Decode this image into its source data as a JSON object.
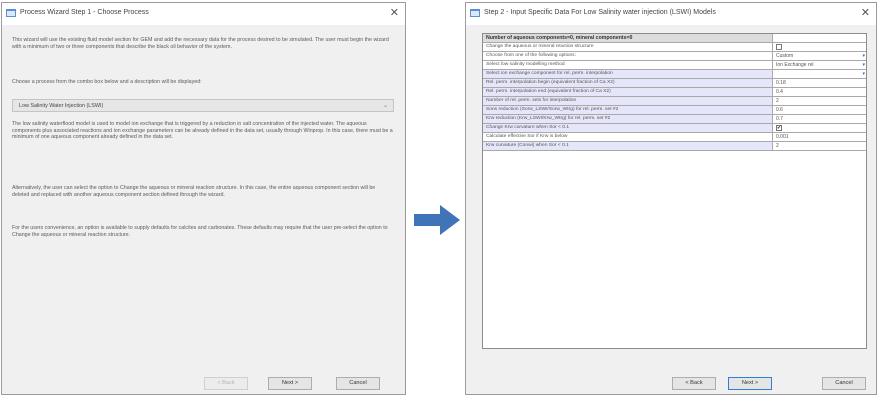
{
  "left_dialog": {
    "title": "Process Wizard Step 1 - Choose Process",
    "close": "✕",
    "paragraphs": [
      "This wizard will use the existing fluid model section for GEM and add the necessary data for the process desired to be simulated. The user must begin the wizard with a minimum of two or three components that describe the black oil behavior of the system.",
      "Choose a process from the combo box below and a description will be displayed:",
      "The low salinity waterflood model is used to model ion exchange that is triggered by a reduction in salt concentration of the injected water. The aqueous components plus associated reactions and ion exchange parameters can be already defined in the data set, usually through Winprop. In this case, there must be a minimum of one aqueous component already defined in the data set.",
      "Alternatively, the user can select the option to Change the aqueous or mineral reaction structure. In this case, the entire aqueous component section will be deleted and replaced with another aqueous component section defined through the wizard.",
      "For the users convenience, an option is available to supply defaults for calcites and carbonates. These defaults may require that the user pre-select the option to Change the aqueous or mineral reaction structure."
    ],
    "combo_value": "Low Salinity Water Injection (LSWI)",
    "buttons": {
      "back": "< Back",
      "next": "Next >",
      "cancel": "Cancel"
    }
  },
  "right_dialog": {
    "title": "Step 2 - Input Specific Data For Low Salinity water injection (LSWI) Models",
    "close": "✕",
    "header_row": "Number of aqueous components=0, mineral components=0",
    "rows": [
      {
        "label": "Change the aqueous or mineral reaction structure",
        "value": "",
        "kind": "checkbox",
        "checked": false,
        "shade": "white"
      },
      {
        "label": "Choose from one of the following options:",
        "value": "Custom",
        "kind": "dropdown",
        "shade": "white"
      },
      {
        "label": "Select low salinity modelling method",
        "value": "Ion Exchange rel",
        "kind": "dropdown",
        "shade": "white"
      },
      {
        "label": "Select ion exchange component for rel. perm. interpolation",
        "value": "",
        "kind": "dropdown",
        "shade": "purple"
      },
      {
        "label": "Rel. perm. interpolation begin (equivalent fraction of Ca X2)",
        "value": "0.18",
        "kind": "text",
        "shade": "purple"
      },
      {
        "label": "Rel. perm. interpolation end (equivalent fraction of Ca X2)",
        "value": "0.4",
        "kind": "text",
        "shade": "purple"
      },
      {
        "label": "Number of rel. perm. sets for interpolation",
        "value": "2",
        "kind": "text",
        "shade": "purple"
      },
      {
        "label": "Sorw reduction (Sorw_LSWI/Sorw_Wtrg) for rel. perm. set #2",
        "value": "0.6",
        "kind": "text",
        "shade": "purple"
      },
      {
        "label": "Krw reduction (Krw_LSWI/Krw_Wtrg) for rel. perm. set #2",
        "value": "0.7",
        "kind": "text",
        "shade": "purple"
      },
      {
        "label": "Change Krw curvature when Sor < 0.1",
        "value": "",
        "kind": "checkbox",
        "checked": true,
        "shade": "purple"
      },
      {
        "label": "Calculate effective Sor if Krw is below",
        "value": "0.001",
        "kind": "text",
        "shade": "white"
      },
      {
        "label": "Krw curvature (Conwi) when Sor < 0.1",
        "value": "2",
        "kind": "text",
        "shade": "purple"
      }
    ],
    "buttons": {
      "back": "< Back",
      "next": "Next >",
      "cancel": "Cancel"
    }
  },
  "colors": {
    "accent": "#2f7fd5",
    "arrow": "#3f74b8",
    "row_shade": "#e6e6fa",
    "header_shade": "#dcdcdc"
  }
}
